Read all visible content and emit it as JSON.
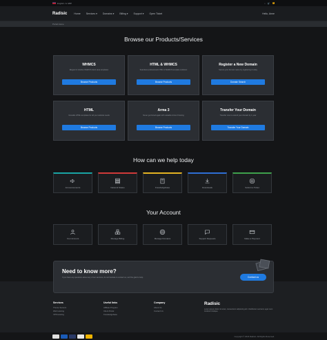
{
  "topbar": {
    "locale": "English / £ GBP",
    "cart_count": "0"
  },
  "navbar": {
    "brand": "Radisic",
    "items": [
      "Home",
      "Services ▾",
      "Domains ▾",
      "Billing ▾",
      "Support ▾",
      "Open Ticket"
    ],
    "user": "Hello, Anne"
  },
  "breadcrumb": "Portal Home",
  "products": {
    "title": "Browse our Products/Services",
    "items": [
      {
        "title": "WHMCS",
        "desc": "Elegant & intuitive WHMCS client area templates",
        "button": "Browse Products"
      },
      {
        "title": "HTML & WHMCS",
        "desc": "Seamless professional HTML & WHMCS template solutions",
        "button": "Browse Products"
      },
      {
        "title": "Register a New Domain",
        "desc": "Secure your domain name by registering it today",
        "button": "Domain Search"
      },
      {
        "title": "HTML",
        "desc": "Versatile HTML templates for all your website needs",
        "button": "Browse Products"
      },
      {
        "title": "Arma 3",
        "desc": "Never get bored again with valuable Arma 3 hosting",
        "button": "Browse Products"
      },
      {
        "title": "Transfer Your Domain",
        "desc": "Transfer now to extend your domain by 1 year",
        "button": "Transfer Your Domain"
      }
    ]
  },
  "help": {
    "title": "How can we help today",
    "items": [
      {
        "label": "Announcements",
        "icon": "megaphone-icon",
        "accent": "#1aa6a6"
      },
      {
        "label": "Network Status",
        "icon": "server-icon",
        "accent": "#d23a3a"
      },
      {
        "label": "Knowledgebase",
        "icon": "book-icon",
        "accent": "#e6b422"
      },
      {
        "label": "Downloads",
        "icon": "download-icon",
        "accent": "#2f6fd6"
      },
      {
        "label": "Submit a Ticket",
        "icon": "lifebuoy-icon",
        "accent": "#3fa34d"
      }
    ]
  },
  "account": {
    "title": "Your Account",
    "items": [
      {
        "label": "Your Account",
        "icon": "user-icon"
      },
      {
        "label": "Manage Billing",
        "icon": "boxes-icon"
      },
      {
        "label": "Manage Domains",
        "icon": "globe-icon"
      },
      {
        "label": "Support Requests",
        "icon": "chat-icon"
      },
      {
        "label": "Make a Payment",
        "icon": "card-icon"
      }
    ]
  },
  "need": {
    "title": "Need to know more?",
    "desc": "If you have any questions about any of our services, do not hesitate to contact us, we'll be glad to help.",
    "button": "Contact us"
  },
  "footer": {
    "cols": [
      {
        "heading": "Services",
        "links": [
          "Theme Servers",
          "Web Hosting",
          "VPS Hosting"
        ]
      },
      {
        "heading": "Useful links",
        "links": [
          "Affiliate Program",
          "Client Portal",
          "Knowledgebase"
        ]
      },
      {
        "heading": "Company",
        "links": [
          "About Us",
          "Contact Us"
        ]
      }
    ],
    "brand": "Radisic",
    "brand_desc": "Lorem ipsum dolor sit amet, consectetur adipiscing elit. Vestibulum sed arcu eget nunc tincidunt tristique.",
    "copyright": "Copyright © 2024 Radisic. All Rights Reserved.",
    "payments": [
      "#e0e0e0",
      "#1a5bb8",
      "#2b3a67",
      "#e8e8e8",
      "#f0b400"
    ]
  },
  "colors": {
    "accent": "#1f7ae0",
    "background": "#141517",
    "card": "#2b2e33"
  }
}
